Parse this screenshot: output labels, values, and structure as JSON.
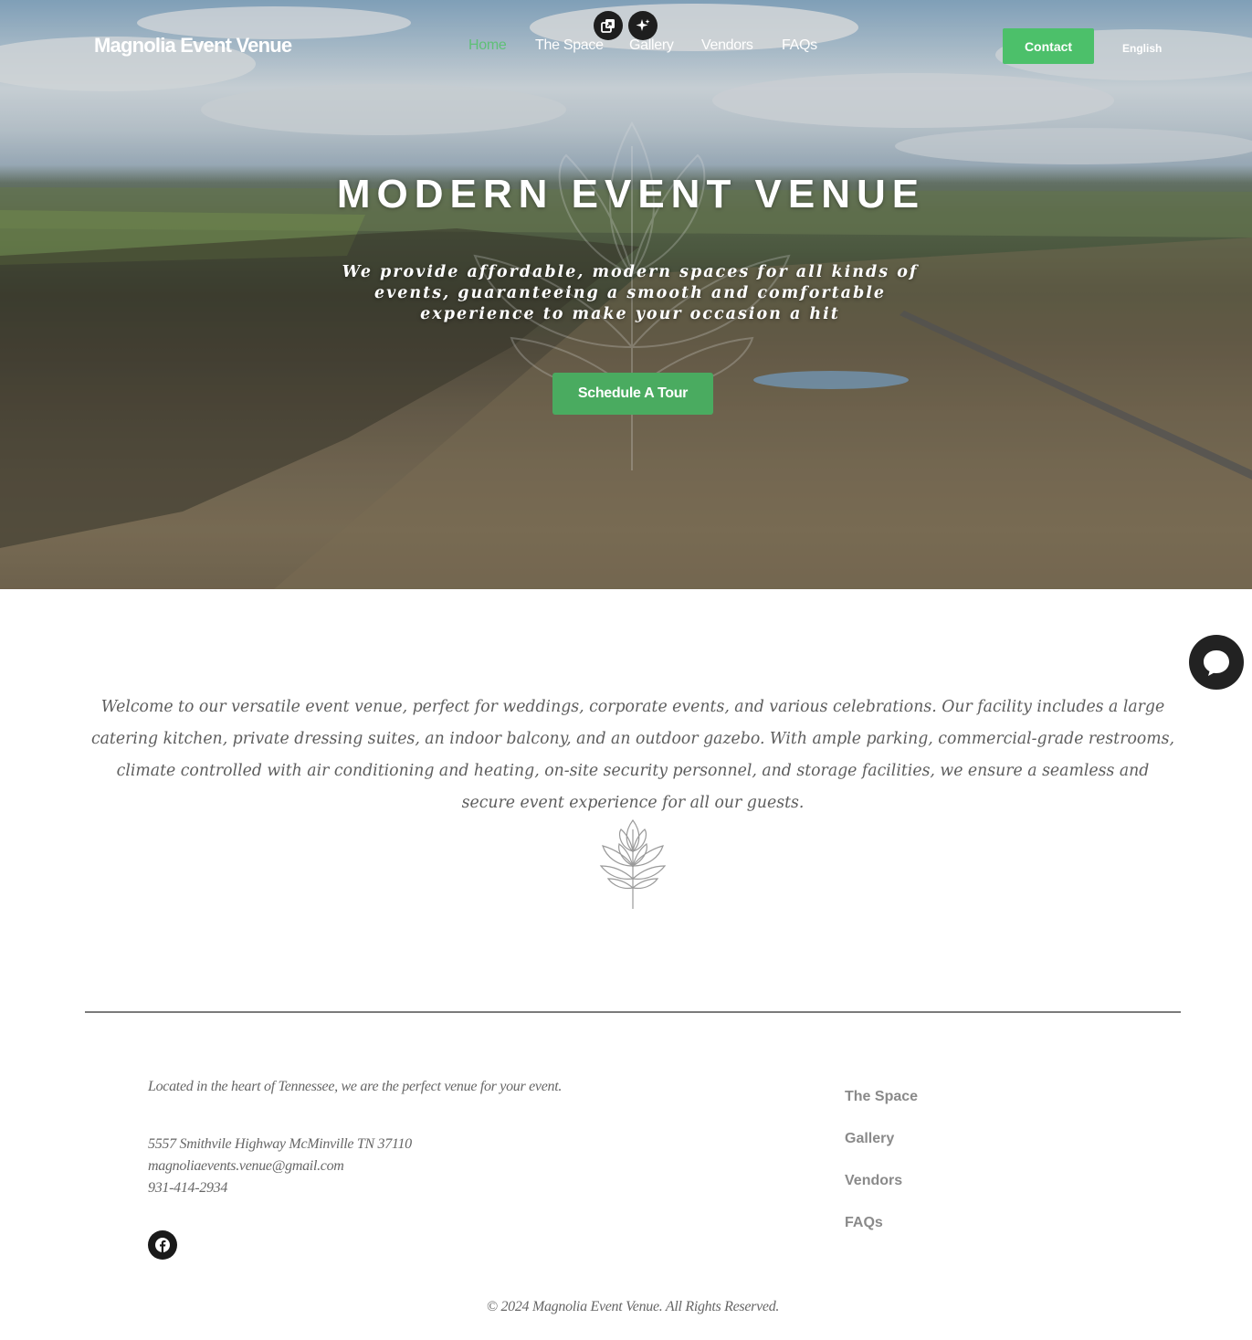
{
  "header": {
    "logo": "Magnolia Event Venue",
    "nav": [
      {
        "label": "Home",
        "active": true
      },
      {
        "label": "The Space",
        "active": false
      },
      {
        "label": "Gallery",
        "active": false
      },
      {
        "label": "Vendors",
        "active": false
      },
      {
        "label": "FAQs",
        "active": false
      }
    ],
    "contact_label": "Contact",
    "language": "English",
    "floating_icons": [
      "copy-gallery-icon",
      "sparkle-icon"
    ]
  },
  "hero": {
    "title": "MODERN EVENT VENUE",
    "subtitle": "We provide affordable, modern spaces for all kinds of events, guaranteeing a smooth and comfortable experience to make your occasion a hit",
    "cta_label": "Schedule A Tour"
  },
  "welcome": {
    "text": "Welcome to our versatile event venue, perfect for weddings, corporate events, and various celebrations. Our facility includes a large catering kitchen, private dressing suites, an indoor balcony, and an outdoor gazebo. With ample parking, commercial-grade restrooms, climate controlled with air conditioning and heating, on-site security personnel, and storage facilities, we ensure a seamless and secure event experience for all our guests."
  },
  "footer": {
    "tagline": "Located in the heart of Tennessee, we are the perfect venue for your event.",
    "address": "5557 Smithvile Highway McMinville TN 37110",
    "email": "magnoliaevents.venue@gmail.com",
    "phone": "931-414-2934",
    "links": [
      "The Space",
      "Gallery",
      "Vendors",
      "FAQs"
    ],
    "copyright": "© 2024 Magnolia Event Venue. All Rights Reserved."
  },
  "colors": {
    "accent_green": "#4cc06a",
    "button_green": "#4aab60",
    "active_nav": "#5fc077"
  }
}
